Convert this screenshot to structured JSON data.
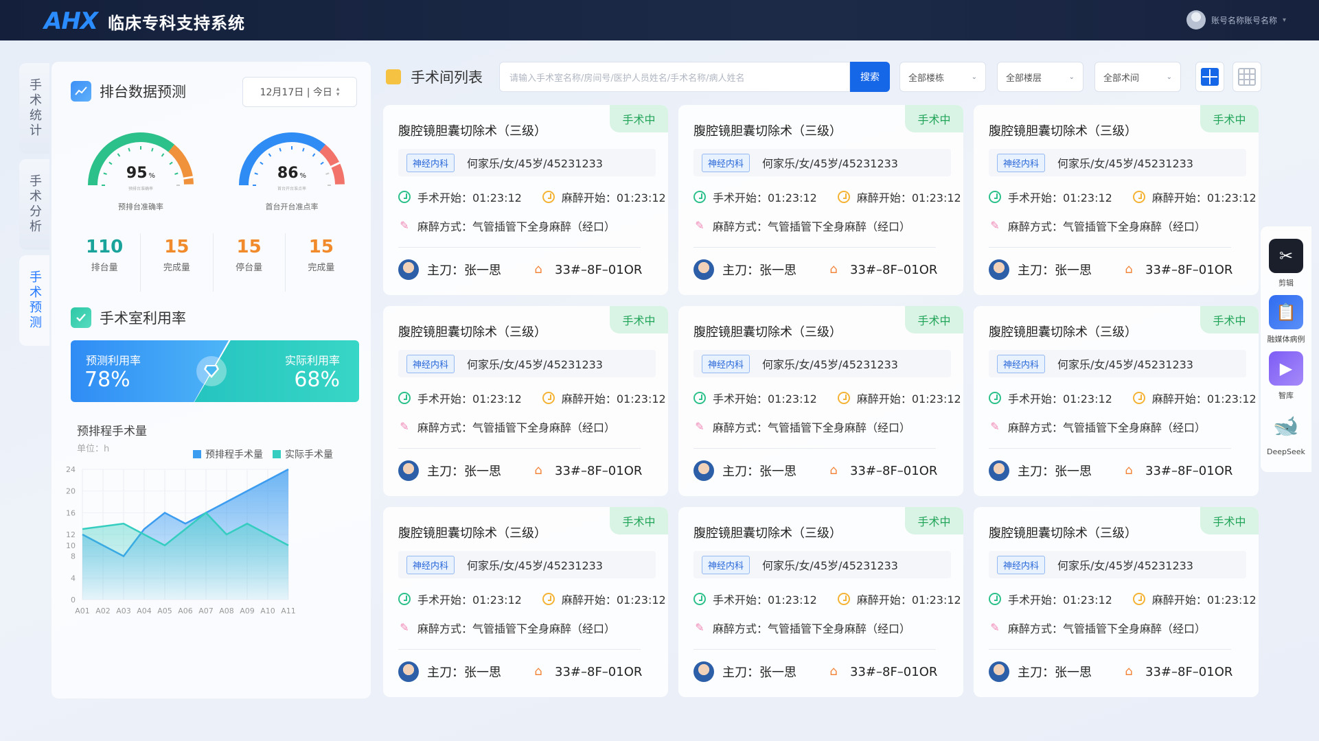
{
  "header": {
    "logo_text": "AHX",
    "app_title": "临床专科支持系统",
    "account_name": "账号名称账号名称"
  },
  "side_tabs": [
    {
      "label": "手术统计",
      "active": false
    },
    {
      "label": "手术分析",
      "active": false
    },
    {
      "label": "手术预测",
      "active": true
    }
  ],
  "forecast": {
    "title": "排台数据预测",
    "date_label": "12月17日 | 今日",
    "gauges": [
      {
        "value": "95",
        "unit": "%",
        "sublabel": "预排台准确率",
        "caption": "预排台准确率",
        "fraction": 0.95
      },
      {
        "value": "86",
        "unit": "%",
        "sublabel": "首台开台准点率",
        "caption": "首台开台准点率",
        "fraction": 0.86
      }
    ],
    "stats": [
      {
        "value": "110",
        "label": "排台量",
        "color": "teal"
      },
      {
        "value": "15",
        "label": "完成量",
        "color": "orange"
      },
      {
        "value": "15",
        "label": "停台量",
        "color": "orange"
      },
      {
        "value": "15",
        "label": "完成量",
        "color": "orange"
      }
    ]
  },
  "utilization": {
    "title": "手术室利用率",
    "predicted_label": "预测利用率",
    "predicted_value": "78%",
    "actual_label": "实际利用率",
    "actual_value": "68%"
  },
  "chart_section": {
    "title": "预排程手术量",
    "unit": "单位：h"
  },
  "chart_data": {
    "type": "area",
    "categories": [
      "A01",
      "A02",
      "A03",
      "A04",
      "A05",
      "A06",
      "A07",
      "A08",
      "A09",
      "A10",
      "A11"
    ],
    "y_ticks": [
      0,
      4,
      8,
      10,
      12,
      16,
      20,
      24
    ],
    "ylim": [
      0,
      24
    ],
    "series": [
      {
        "name": "预排程手术量",
        "color": "#3c9cf0",
        "values": [
          12,
          10,
          8,
          13,
          16,
          14,
          16,
          18,
          20,
          22,
          24
        ]
      },
      {
        "name": "实际手术量",
        "color": "#35cdbf",
        "values": [
          13,
          13.5,
          14,
          12,
          10,
          13,
          16,
          12,
          14,
          12,
          10
        ]
      }
    ]
  },
  "main": {
    "title": "手术间列表",
    "search_placeholder": "请输入手术室名称/房间号/医护人员姓名/手术名称/病人姓名",
    "search_button": "搜索",
    "filters": [
      "全部楼栋",
      "全部楼层",
      "全部术间"
    ]
  },
  "cards": [
    {
      "title": "腹腔镜胆囊切除术（三级）",
      "status": "手术中",
      "dept": "神经内科",
      "patient": "何家乐/女/45岁/45231233",
      "start": "手术开始：01:23:12",
      "anes_start": "麻醉开始：01:23:12",
      "anes_method": "麻醉方式：气管插管下全身麻醉（经口）",
      "surgeon": "主刀：张一思",
      "room": "33#–8F–01OR"
    },
    {
      "title": "腹腔镜胆囊切除术（三级）",
      "status": "手术中",
      "dept": "神经内科",
      "patient": "何家乐/女/45岁/45231233",
      "start": "手术开始：01:23:12",
      "anes_start": "麻醉开始：01:23:12",
      "anes_method": "麻醉方式：气管插管下全身麻醉（经口）",
      "surgeon": "主刀：张一思",
      "room": "33#–8F–01OR"
    },
    {
      "title": "腹腔镜胆囊切除术（三级）",
      "status": "手术中",
      "dept": "神经内科",
      "patient": "何家乐/女/45岁/45231233",
      "start": "手术开始：01:23:12",
      "anes_start": "麻醉开始：01:23:12",
      "anes_method": "麻醉方式：气管插管下全身麻醉（经口）",
      "surgeon": "主刀：张一思",
      "room": "33#–8F–01OR"
    },
    {
      "title": "腹腔镜胆囊切除术（三级）",
      "status": "手术中",
      "dept": "神经内科",
      "patient": "何家乐/女/45岁/45231233",
      "start": "手术开始：01:23:12",
      "anes_start": "麻醉开始：01:23:12",
      "anes_method": "麻醉方式：气管插管下全身麻醉（经口）",
      "surgeon": "主刀：张一思",
      "room": "33#–8F–01OR"
    },
    {
      "title": "腹腔镜胆囊切除术（三级）",
      "status": "手术中",
      "dept": "神经内科",
      "patient": "何家乐/女/45岁/45231233",
      "start": "手术开始：01:23:12",
      "anes_start": "麻醉开始：01:23:12",
      "anes_method": "麻醉方式：气管插管下全身麻醉（经口）",
      "surgeon": "主刀：张一思",
      "room": "33#–8F–01OR"
    },
    {
      "title": "腹腔镜胆囊切除术（三级）",
      "status": "手术中",
      "dept": "神经内科",
      "patient": "何家乐/女/45岁/45231233",
      "start": "手术开始：01:23:12",
      "anes_start": "麻醉开始：01:23:12",
      "anes_method": "麻醉方式：气管插管下全身麻醉（经口）",
      "surgeon": "主刀：张一思",
      "room": "33#–8F–01OR"
    },
    {
      "title": "腹腔镜胆囊切除术（三级）",
      "status": "手术中",
      "dept": "神经内科",
      "patient": "何家乐/女/45岁/45231233",
      "start": "手术开始：01:23:12",
      "anes_start": "麻醉开始：01:23:12",
      "anes_method": "麻醉方式：气管插管下全身麻醉（经口）",
      "surgeon": "主刀：张一思",
      "room": "33#–8F–01OR"
    },
    {
      "title": "腹腔镜胆囊切除术（三级）",
      "status": "手术中",
      "dept": "神经内科",
      "patient": "何家乐/女/45岁/45231233",
      "start": "手术开始：01:23:12",
      "anes_start": "麻醉开始：01:23:12",
      "anes_method": "麻醉方式：气管插管下全身麻醉（经口）",
      "surgeon": "主刀：张一思",
      "room": "33#–8F–01OR"
    },
    {
      "title": "腹腔镜胆囊切除术（三级）",
      "status": "手术中",
      "dept": "神经内科",
      "patient": "何家乐/女/45岁/45231233",
      "start": "手术开始：01:23:12",
      "anes_start": "麻醉开始：01:23:12",
      "anes_method": "麻醉方式：气管插管下全身麻醉（经口）",
      "surgeon": "主刀：张一思",
      "room": "33#–8F–01OR"
    }
  ],
  "dock": [
    {
      "label": "剪辑",
      "icon": "scissors-icon",
      "color": "#1a1f2b"
    },
    {
      "label": "融媒体病例",
      "icon": "clipboard-icon",
      "color": "#2f6cf0"
    },
    {
      "label": "智库",
      "icon": "film-icon",
      "color": "#7d5cf5"
    },
    {
      "label": "DeepSeek",
      "icon": "whale-icon",
      "color": "#3a6df0"
    }
  ]
}
